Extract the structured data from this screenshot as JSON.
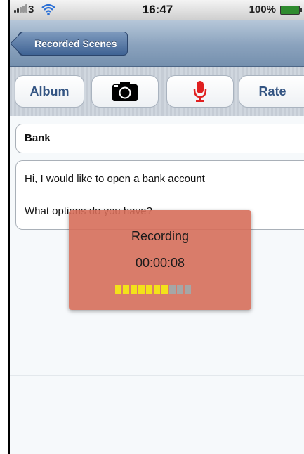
{
  "status_bar": {
    "carrier": "3",
    "time": "16:47",
    "battery": "100%"
  },
  "nav": {
    "back_label": "Recorded Scenes"
  },
  "toolbar": {
    "album_label": "Album",
    "camera_icon": "camera-icon",
    "mic_icon": "microphone-icon",
    "mic_color": "#e02020",
    "rate_label": "Rate"
  },
  "scene": {
    "title": "Bank",
    "lines": [
      "Hi, I would like to open a bank account",
      "What options do you have?"
    ]
  },
  "recording": {
    "title": "Recording",
    "elapsed": "00:00:08",
    "level_segments_total": 10,
    "level_segments_active": 7,
    "overlay_color": "#d66e5a",
    "meter_active_color": "#f3e21a"
  },
  "colors": {
    "nav_bar": "#8aa2bd",
    "button_text": "#345583"
  }
}
